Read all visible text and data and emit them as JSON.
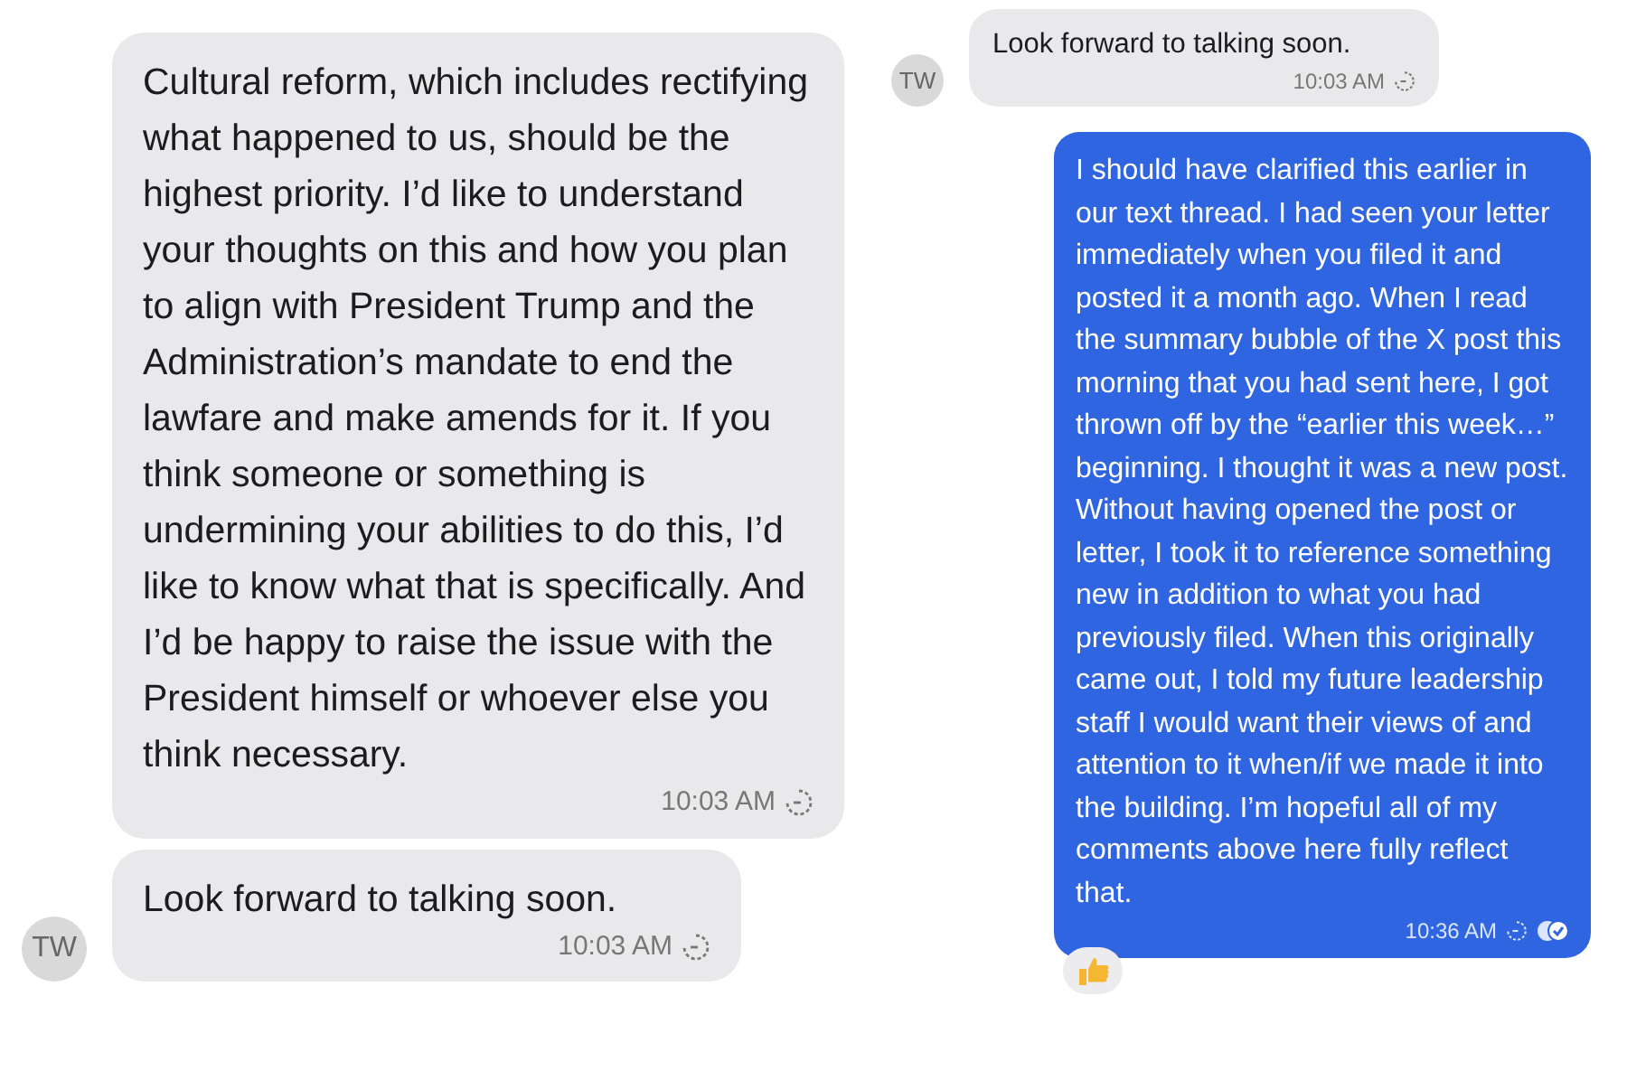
{
  "panels": [
    {
      "messages": [
        {
          "kind": "incoming",
          "text": "Cultural reform, which includes rectifying what happened to us, should be the highest priority. I’d like to understand your thoughts on this and how you plan to align with President Trump and the Administration’s mandate to end the lawfare and make amends for it. If you think someone or something is undermining your abilities to do this, I’d like to know what that is specifically. And I’d be happy to raise the issue with the President himself or whoever else you think necessary.",
          "time": "10:03 AM"
        },
        {
          "kind": "incoming",
          "text": "Look forward to talking soon.",
          "time": "10:03 AM",
          "avatar": "TW"
        }
      ]
    },
    {
      "messages": [
        {
          "kind": "incoming",
          "text": "Look forward to talking soon.",
          "time": "10:03 AM",
          "avatar": "TW"
        },
        {
          "kind": "outgoing",
          "text": "I should have clarified this earlier in our text thread. I had seen your letter immediately when you filed it and posted it a month ago. When I read the summary bubble of the X post this morning that you had sent here, I got thrown off by the  “earlier this week…” beginning. I thought it was a new post. Without having opened the post or letter, I took it to reference something new in addition to what you had previously filed. When this originally came out, I told my future leadership staff I would want their views of and attention to it when/if we made it into the building. I’m hopeful all of my comments above here fully reflect that.",
          "time": "10:36 AM",
          "read": true,
          "reacted": true
        }
      ]
    }
  ]
}
